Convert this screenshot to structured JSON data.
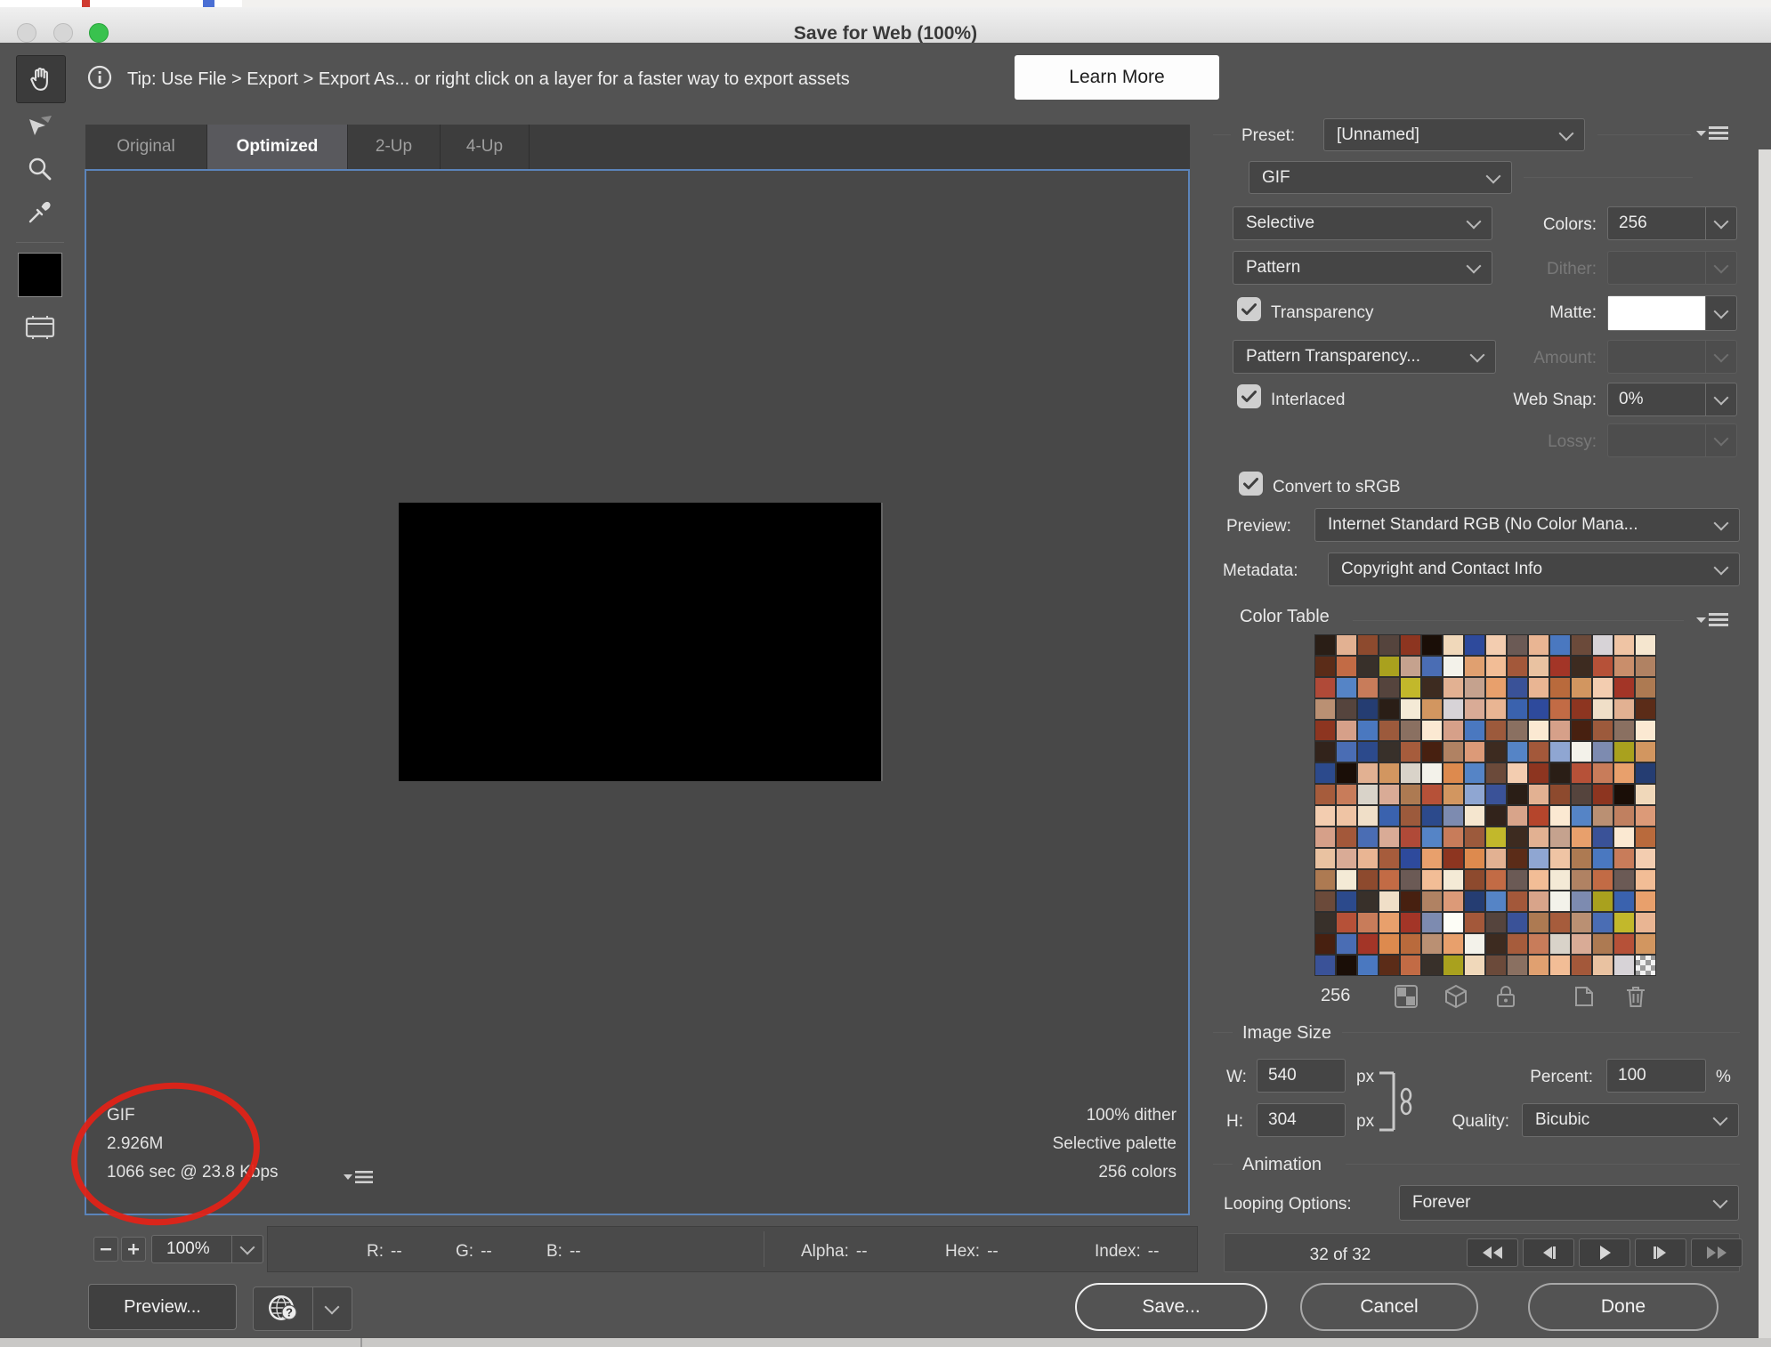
{
  "window": {
    "title": "Save for Web (100%)"
  },
  "tip_bar": {
    "text": "Tip: Use File > Export > Export As...  or right click on a layer for a faster way to export assets",
    "learn_more_label": "Learn More"
  },
  "view_tabs": [
    {
      "label": "Original",
      "active": false
    },
    {
      "label": "Optimized",
      "active": true
    },
    {
      "label": "2-Up",
      "active": false
    },
    {
      "label": "4-Up",
      "active": false
    }
  ],
  "toolbar": {
    "swatch_color": "#000000"
  },
  "preview": {
    "image_color": "#000000",
    "border_color": "#5b84ba",
    "info_left": [
      "GIF",
      "2.926M",
      "1066 sec @ 23.8 Kbps"
    ],
    "info_right": [
      "100% dither",
      "Selective palette",
      "256 colors"
    ],
    "annotation_color": "#e02318"
  },
  "status_bar": {
    "zoom_level": "100%",
    "readouts": [
      {
        "label": "R:",
        "value": "--"
      },
      {
        "label": "G:",
        "value": "--"
      },
      {
        "label": "B:",
        "value": "--"
      },
      {
        "label": "Alpha:",
        "value": "--"
      },
      {
        "label": "Hex:",
        "value": "--"
      },
      {
        "label": "Index:",
        "value": "--"
      }
    ]
  },
  "footer": {
    "preview_button": "Preview...",
    "save_button": "Save...",
    "cancel_button": "Cancel",
    "done_button": "Done"
  },
  "panel": {
    "preset_label": "Preset:",
    "preset_value": "[Unnamed]",
    "format_value": "GIF",
    "palette_mode_value": "Selective",
    "colors_label": "Colors:",
    "colors_value": "256",
    "dither_mode_value": "Pattern",
    "dither_label": "Dither:",
    "transparency_label": "Transparency",
    "transparency_checked": true,
    "matte_label": "Matte:",
    "matte_color": "#ffffff",
    "transparency_dither_value": "Pattern Transparency...",
    "amount_label": "Amount:",
    "interlaced_label": "Interlaced",
    "interlaced_checked": true,
    "web_snap_label": "Web Snap:",
    "web_snap_value": "0%",
    "lossy_label": "Lossy:",
    "convert_srgb_label": "Convert to sRGB",
    "convert_srgb_checked": true,
    "preview_label": "Preview:",
    "preview_value": "Internet Standard RGB (No Color Mana...",
    "metadata_label": "Metadata:",
    "metadata_value": "Copyright and Contact Info",
    "color_table": {
      "title": "Color Table",
      "count": "256",
      "grid": {
        "rows": 16,
        "cols": 16
      },
      "last_cell": "transparency-checker",
      "palette": [
        "#2a1e16",
        "#1a0e07",
        "#e9b593",
        "#f5e6cf",
        "#f0dfc8",
        "#d6a089",
        "#f2bd96",
        "#a9a11e",
        "#fdfdf6",
        "#5584c6",
        "#b96a3c",
        "#a65c3c",
        "#b65138",
        "#e2b192",
        "#f0d8ba",
        "#4a78c0",
        "#f4ead6",
        "#32231b",
        "#3a62ae",
        "#c98e6b",
        "#a3583a",
        "#c5a28e",
        "#472010",
        "#ba9073",
        "#c87c5a",
        "#d29660",
        "#8d4a2e",
        "#2e4a9c",
        "#6b4a3a",
        "#5b2c18",
        "#c08060",
        "#d8a48a",
        "#9c5a3c",
        "#b08263",
        "#e9c2a1",
        "#4a6db4",
        "#e8a06c",
        "#d9d3c9",
        "#8fa6d2",
        "#55443d",
        "#f3cdb0",
        "#d7d3d7",
        "#8a7061",
        "#c26b45",
        "#dc9a78",
        "#b5452c",
        "#2c4a8c",
        "#c2b82b",
        "#a33527",
        "#f3f2ea",
        "#d9ab96",
        "#3a5298",
        "#8d3520",
        "#6b5a55",
        "#efc4a4",
        "#253d72",
        "#e0a070",
        "#38302a",
        "#b04a38",
        "#fbe9d2",
        "#7d8bb0",
        "#dd8a4e",
        "#3d2b20",
        "#ad7a52"
      ]
    },
    "image_size": {
      "title": "Image Size",
      "w_label": "W:",
      "w_value": "540",
      "w_unit": "px",
      "h_label": "H:",
      "h_value": "304",
      "h_unit": "px",
      "percent_label": "Percent:",
      "percent_value": "100",
      "percent_unit": "%",
      "quality_label": "Quality:",
      "quality_value": "Bicubic"
    },
    "animation": {
      "title": "Animation",
      "looping_label": "Looping Options:",
      "looping_value": "Forever",
      "frame_counter": "32 of 32"
    }
  }
}
